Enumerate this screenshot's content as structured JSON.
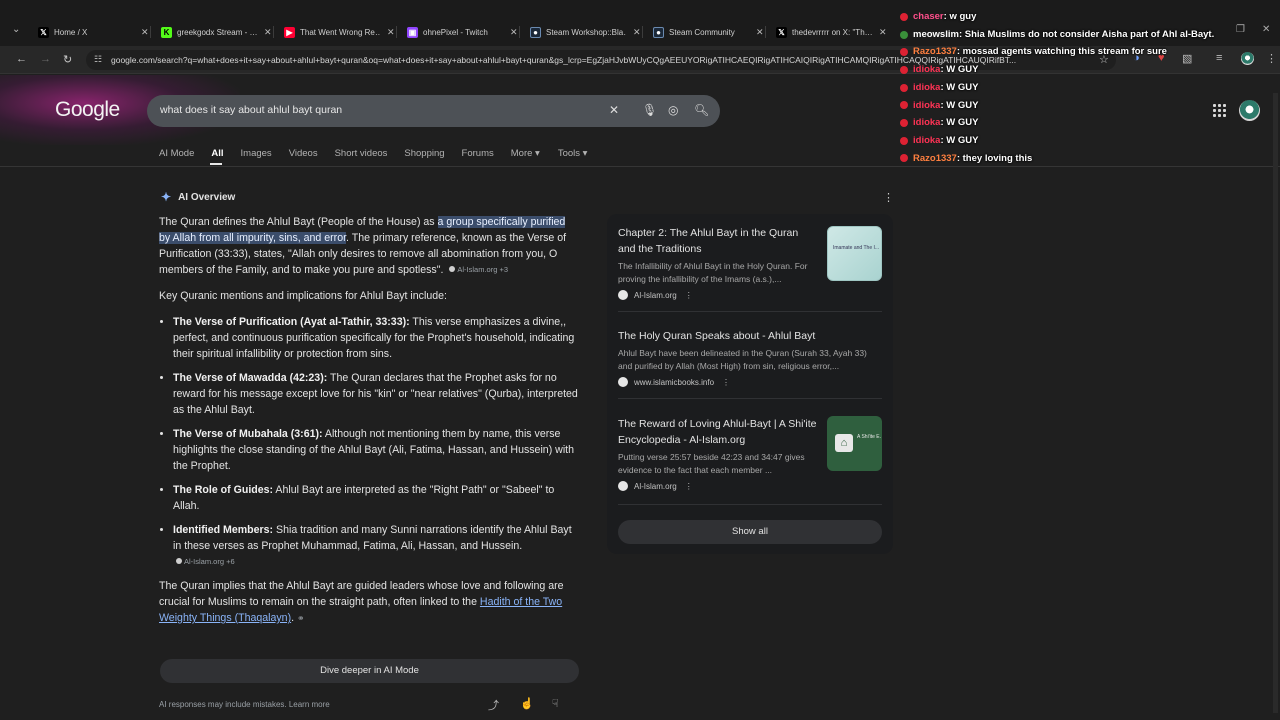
{
  "browser": {
    "tabs": [
      {
        "title": "Home / X",
        "icon": "x-logo-icon",
        "color": "#000000"
      },
      {
        "title": "greekgodx Stream - …",
        "icon": "kick-logo-icon",
        "color": "#53fc18"
      },
      {
        "title": "That Went Wrong Re…",
        "icon": "youtube-logo-icon",
        "color": "#ff0033"
      },
      {
        "title": "ohnePixel - Twitch",
        "icon": "twitch-logo-icon",
        "color": "#9146ff"
      },
      {
        "title": "Steam Workshop::Bla…",
        "icon": "steam-logo-icon",
        "color": "#1b2838"
      },
      {
        "title": "Steam Community",
        "icon": "steam-logo-icon",
        "color": "#1b2838"
      },
      {
        "title": "thedevrrrrr on X: \"Th…",
        "icon": "x-logo-icon",
        "color": "#000000"
      }
    ],
    "url": "google.com/search?q=what+does+it+say+about+ahlul+bayt+quran&oq=what+does+it+say+about+ahlul+bayt+quran&gs_lcrp=EgZjaHJvbWUyCQgAEEUYORigATIHCAEQIRigATIHCAIQIRigATIHCAMQIRigATIHCAQQIRigATIHCAUQIRifBT..."
  },
  "google": {
    "logo": "Google",
    "query": "what does it say about ahlul bayt quran",
    "filters": [
      "AI Mode",
      "All",
      "Images",
      "Videos",
      "Short videos",
      "Shopping",
      "Forums",
      "More",
      "Tools"
    ],
    "active_filter": "All",
    "more_label": "More ▾",
    "tools_label": "Tools ▾"
  },
  "ai_overview": {
    "heading": "AI Overview",
    "intro_before": "The Quran defines the Ahlul Bayt (People of the House) as ",
    "intro_highlight": "a group specifically purified by Allah from all impurity, sins, and error",
    "intro_after": ". The primary reference, known as the Verse of Purification (33:33), states, \"Allah only desires to remove all abomination from you, O members of the Family, and to make you pure and spotless\".",
    "intro_source": "Al-Islam.org +3",
    "key_heading": "Key Quranic mentions and implications for Ahlul Bayt include:",
    "bullets": [
      {
        "title": "The Verse of Purification (Ayat al-Tathir, 33:33):",
        "text": " This verse emphasizes a divine,, perfect, and continuous purification specifically for the Prophet's household, indicating their spiritual infallibility or protection from sins."
      },
      {
        "title": "The Verse of Mawadda (42:23):",
        "text": " The Quran declares that the Prophet asks for no reward for his message except love for his \"kin\" or \"near relatives\" (Qurba), interpreted as the Ahlul Bayt."
      },
      {
        "title": "The Verse of Mubahala (3:61):",
        "text": " Although not mentioning them by name, this verse highlights the close standing of the Ahlul Bayt (Ali, Fatima, Hassan, and Hussein) with the Prophet."
      },
      {
        "title": "The Role of Guides:",
        "text": " Ahlul Bayt are interpreted as the \"Right Path\" or \"Sabeel\" to Allah."
      },
      {
        "title": "Identified Members:",
        "text": " Shia tradition and many Sunni narrations identify the Ahlul Bayt in these verses as Prophet Muhammad, Fatima, Ali, Hassan, and Hussein.",
        "source": "Al-Islam.org +6"
      }
    ],
    "closing_before": "The Quran implies that the Ahlul Bayt are guided leaders whose love and following are crucial for Muslims to remain on the straight path, often linked to the ",
    "closing_link": "Hadith of the Two Weighty Things (Thaqalayn)",
    "closing_after": ".",
    "deeper_button": "Dive deeper in AI Mode",
    "disclaimer": "AI responses may include mistakes. Learn more"
  },
  "sources": [
    {
      "title": "Chapter 2: The Ahlul Bayt in the Quran and the Traditions",
      "desc": "The Infallibility of Ahlul Bayt in the Holy Quran. For proving the infallibility of the Imams (a.s.),...",
      "site": "Al-Islam.org",
      "thumb_text": "Imamate and The I..."
    },
    {
      "title": "The Holy Quran Speaks about - Ahlul Bayt",
      "desc": "Ahlul Bayt have been delineated in the Quran (Surah 33, Ayah 33) and purified by Allah (Most High) from sin, religious error,...",
      "site": "www.islamicbooks.info"
    },
    {
      "title": "The Reward of Loving Ahlul-Bayt | A Shi'ite Encyclopedia - Al-Islam.org",
      "desc": "Putting verse 25:57 beside 42:23 and 34:47 gives evidence to the fact that each member ...",
      "site": "Al-Islam.org",
      "thumb_text": "A Shi'ite E..."
    }
  ],
  "show_all": "Show all",
  "chat": [
    {
      "user": "chaser",
      "msg": ": w guy",
      "color": "#ff4f8b",
      "badge": "red"
    },
    {
      "user": "meowslim",
      "msg": ": Shia Muslims do not consider Aisha part of Ahl al-Bayt.",
      "color": "#ffffff",
      "badge": "green"
    },
    {
      "user": "Razo1337",
      "msg": ": mossad agents watching this stream for sure",
      "color": "#ff7f3f",
      "badge": "red"
    },
    {
      "user": "idioka",
      "msg": ": W GUY",
      "color": "#ff3355",
      "badge": "red"
    },
    {
      "user": "idioka",
      "msg": ": W GUY",
      "color": "#ff3355",
      "badge": "red"
    },
    {
      "user": "idioka",
      "msg": ": W GUY",
      "color": "#ff3355",
      "badge": "red"
    },
    {
      "user": "idioka",
      "msg": ": W GUY",
      "color": "#ff3355",
      "badge": "red"
    },
    {
      "user": "idioka",
      "msg": ": W GUY",
      "color": "#ff3355",
      "badge": "red"
    },
    {
      "user": "Razo1337",
      "msg": ": they loving this",
      "color": "#ff7f3f",
      "badge": "red"
    }
  ]
}
